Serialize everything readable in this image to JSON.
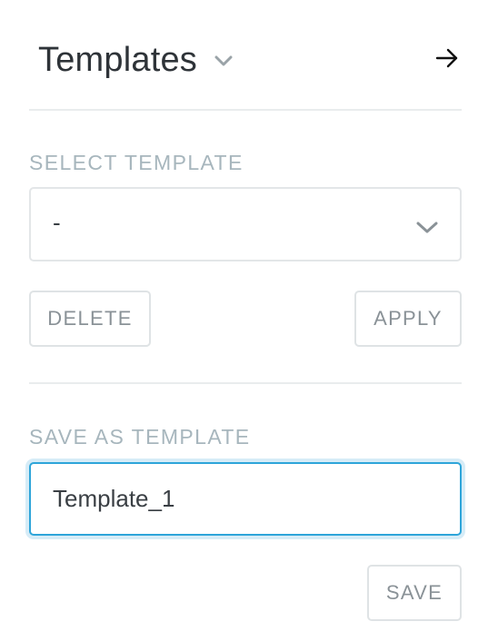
{
  "header": {
    "title": "Templates",
    "title_icon": "chevron-down-icon",
    "collapse_icon": "arrow-right-icon"
  },
  "select_section": {
    "label": "SELECT TEMPLATE",
    "selected_value": "-",
    "dropdown_icon": "chevron-down-icon",
    "delete_label": "DELETE",
    "apply_label": "APPLY"
  },
  "save_section": {
    "label": "SAVE AS TEMPLATE",
    "input_value": "Template_1",
    "save_label": "SAVE"
  },
  "colors": {
    "title_text": "#2e3338",
    "section_label": "#a7b6bd",
    "button_text": "#8a9297",
    "button_border": "#dfe3e5",
    "input_focus_border": "#2ea5d9",
    "divider": "#e9eced"
  }
}
